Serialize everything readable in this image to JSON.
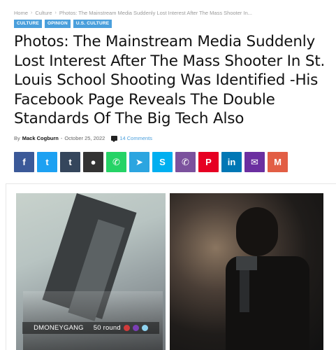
{
  "breadcrumb": {
    "home": "Home",
    "section": "Culture",
    "current": "Photos: The Mainstream Media Suddenly Lost Interest After The Mass Shooter In..."
  },
  "categories": [
    "CULTURE",
    "OPINION",
    "U.S. CULTURE"
  ],
  "article": {
    "title": "Photos: The Mainstream Media Suddenly Lost Interest After The Mass Shooter In St. Louis School Shooting Was Identified -His Facebook Page Reveals The Double Standards Of The Big Tech Also",
    "by_label": "By",
    "author": "Mack Cogburn",
    "separator": "-",
    "date": "October 25, 2022",
    "comments": "14 Comments"
  },
  "share_buttons": [
    {
      "name": "facebook",
      "glyph": "f",
      "color": "#3b5998"
    },
    {
      "name": "twitter",
      "glyph": "t",
      "color": "#1da1f2"
    },
    {
      "name": "tumblr",
      "glyph": "t",
      "color": "#35465c"
    },
    {
      "name": "reddit",
      "glyph": "●",
      "color": "#333333"
    },
    {
      "name": "whatsapp",
      "glyph": "✆",
      "color": "#25d366"
    },
    {
      "name": "telegram",
      "glyph": "➤",
      "color": "#2ca5e0"
    },
    {
      "name": "skype",
      "glyph": "S",
      "color": "#00aff0"
    },
    {
      "name": "viber",
      "glyph": "✆",
      "color": "#7b519d"
    },
    {
      "name": "pinterest",
      "glyph": "P",
      "color": "#e60023"
    },
    {
      "name": "linkedin",
      "glyph": "in",
      "color": "#0077b5"
    },
    {
      "name": "email",
      "glyph": "✉",
      "color": "#6b2fa0"
    },
    {
      "name": "gmail",
      "glyph": "M",
      "color": "#e25e45"
    }
  ],
  "image_caption": {
    "left": "DMONEYGANG",
    "right": "50 round"
  },
  "colors": {
    "accent": "#4a9fdc"
  }
}
